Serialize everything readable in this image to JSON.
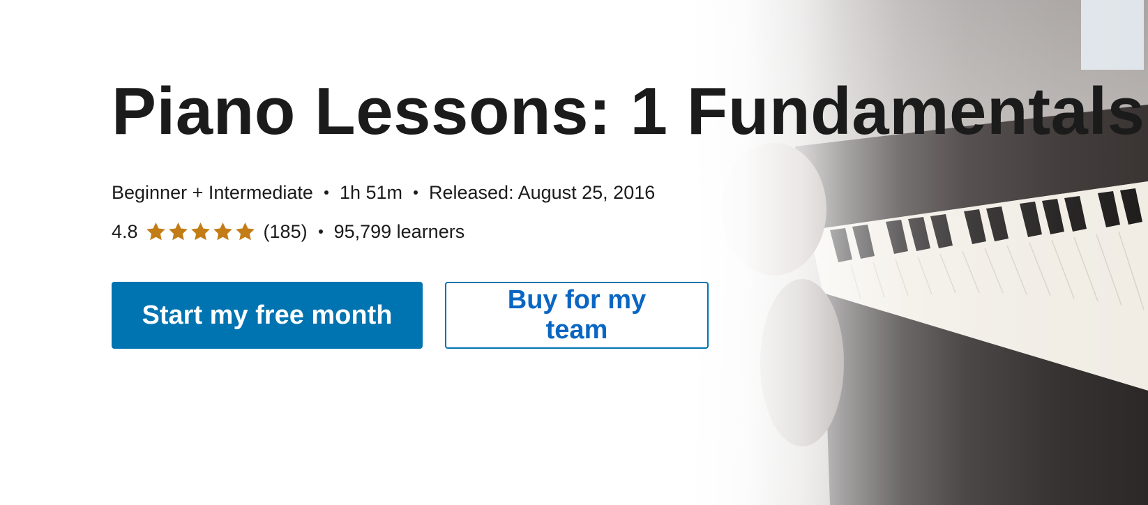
{
  "course": {
    "title": "Piano Lessons: 1 Fundamentals",
    "level": "Beginner + Intermediate",
    "duration": "1h 51m",
    "released": "Released: August 25, 2016",
    "rating": "4.8",
    "rating_fraction": 0.96,
    "stars_total": 5,
    "review_count": "(185)",
    "learners": "95,799 learners"
  },
  "actions": {
    "primary_label": "Start my free month",
    "secondary_label": "Buy for my team"
  },
  "colors": {
    "accent": "#0073b1",
    "star": "#c37d16",
    "text": "#1b1b1b"
  },
  "hero_image": {
    "icon": "piano-keyboard-photo"
  }
}
